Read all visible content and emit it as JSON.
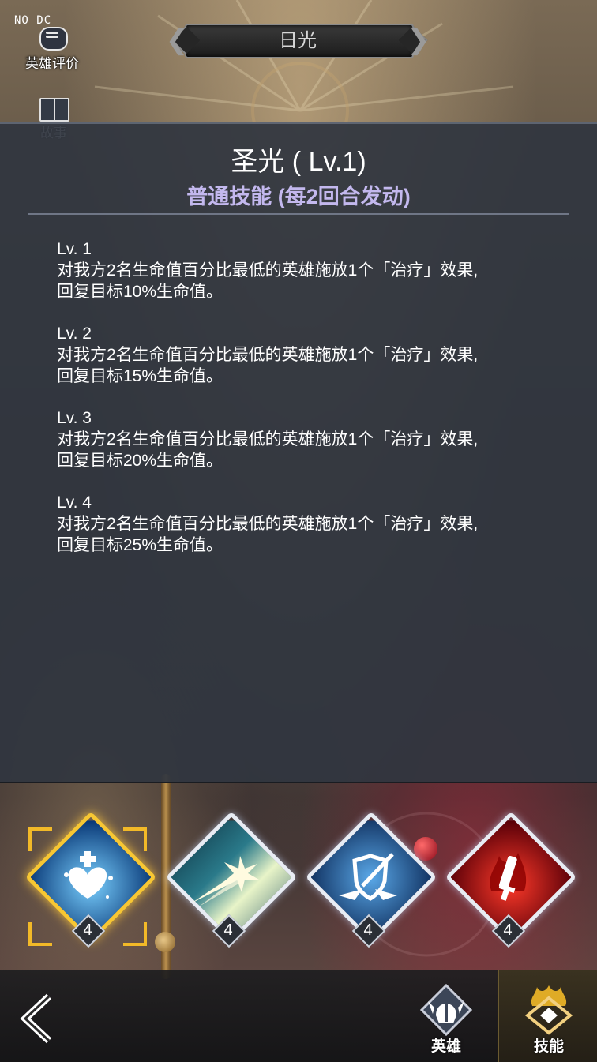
{
  "watermark": "NO DC",
  "side_buttons": {
    "rating_label": "英雄评价",
    "story_label": "故事"
  },
  "header": {
    "title": "日光",
    "prev_arrow": "❮",
    "next_arrow": "❯"
  },
  "skill_detail": {
    "name": "圣光 ( Lv.1)",
    "type": "普通技能 (每2回合发动)",
    "levels": [
      {
        "label": "Lv. 1",
        "desc_line1": "对我方2名生命值百分比最低的英雄施放1个「治疗」效果,",
        "desc_line2": "回复目标10%生命值。"
      },
      {
        "label": "Lv. 2",
        "desc_line1": "对我方2名生命值百分比最低的英雄施放1个「治疗」效果,",
        "desc_line2": "回复目标15%生命值。"
      },
      {
        "label": "Lv. 3",
        "desc_line1": "对我方2名生命值百分比最低的英雄施放1个「治疗」效果,",
        "desc_line2": "回复目标20%生命值。"
      },
      {
        "label": "Lv. 4",
        "desc_line1": "对我方2名生命值百分比最低的英雄施放1个「治疗」效果,",
        "desc_line2": "回复目标25%生命值。"
      }
    ]
  },
  "skills": [
    {
      "icon": "heart-heal-icon",
      "level": "4",
      "selected": true,
      "color": "#1a6fc0"
    },
    {
      "icon": "light-burst-icon",
      "level": "4",
      "selected": false,
      "color": "#2a6a8a"
    },
    {
      "icon": "shield-sword-icon",
      "level": "4",
      "selected": false,
      "color": "#1e5aa8"
    },
    {
      "icon": "flame-sword-icon",
      "level": "4",
      "selected": false,
      "color": "#b01818"
    }
  ],
  "bottom_nav": {
    "back_icon": "back-arrow-icon",
    "hero_label": "英雄",
    "skill_label": "技能"
  },
  "colors": {
    "accent_gold": "#f2b928",
    "skill_type_purple": "#c3b8ee",
    "panel_bg": "#30363f"
  }
}
